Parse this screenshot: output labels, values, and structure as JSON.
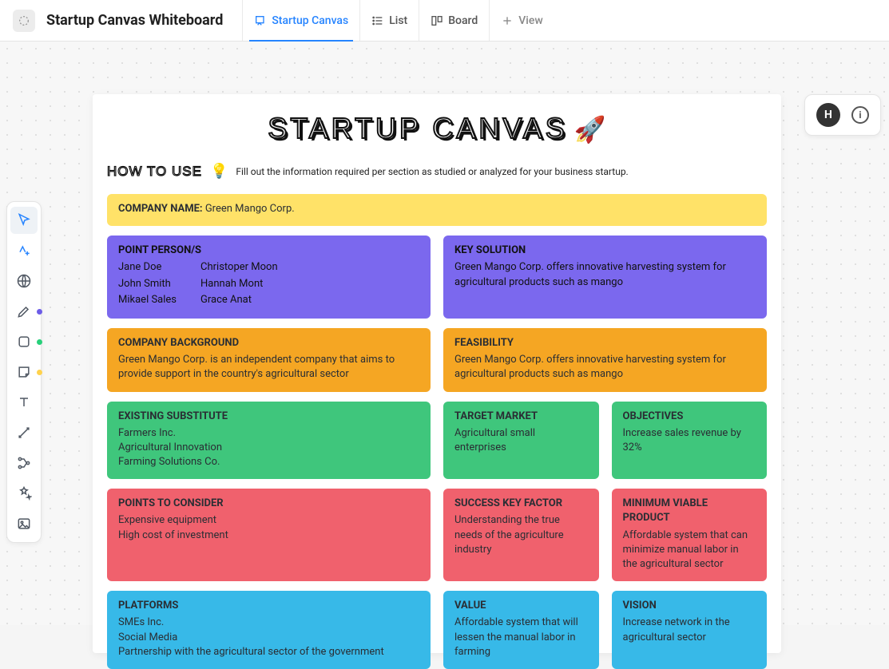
{
  "header": {
    "doc_title": "Startup Canvas Whiteboard",
    "tabs": {
      "canvas": "Startup Canvas",
      "list": "List",
      "board": "Board",
      "view": "View"
    }
  },
  "right": {
    "avatar_initial": "H"
  },
  "canvas": {
    "title": "STARTUP CANVAS",
    "rocket": "🚀",
    "howto_title": "HOW TO USE",
    "bulb": "💡",
    "howto_desc": "Fill out the information required per section as studied or analyzed for your business startup."
  },
  "cards": {
    "company_name": {
      "label": "COMPANY NAME:",
      "value": "Green Mango Corp."
    },
    "point_persons": {
      "label": "POINT PERSON/S",
      "col1": [
        "Jane Doe",
        "John Smith",
        "Mikael Sales"
      ],
      "col2": [
        "Christoper Moon",
        "Hannah Mont",
        "Grace Anat"
      ]
    },
    "key_solution": {
      "label": "KEY SOLUTION",
      "body": "Green Mango Corp. offers innovative harvesting system for agricultural products such as mango"
    },
    "company_background": {
      "label": "COMPANY BACKGROUND",
      "body": "Green Mango Corp. is an independent company that aims to provide support in the country's agricultural sector"
    },
    "feasibility": {
      "label": "FEASIBILITY",
      "body": "Green Mango Corp. offers innovative harvesting system for agricultural products such as mango"
    },
    "existing_substitute": {
      "label": "EXISTING SUBSTITUTE",
      "lines": [
        "Farmers Inc.",
        "Agricultural Innovation",
        "Farming Solutions Co."
      ]
    },
    "target_market": {
      "label": "TARGET MARKET",
      "body": "Agricultural small enterprises"
    },
    "objectives": {
      "label": "OBJECTIVES",
      "body": "Increase sales revenue by 32%"
    },
    "points_to_consider": {
      "label": "POINTS TO CONSIDER",
      "lines": [
        "Expensive equipment",
        "High cost of investment"
      ]
    },
    "success_key_factor": {
      "label": "SUCCESS KEY FACTOR",
      "body": "Understanding the true needs of the agriculture industry"
    },
    "mvp": {
      "label": "MINIMUM VIABLE PRODUCT",
      "body": "Affordable system that can minimize manual labor in the agricultural sector"
    },
    "platforms": {
      "label": "PLATFORMS",
      "lines": [
        "SMEs Inc.",
        "Social Media",
        "Partnership with the agricultural sector of the government"
      ]
    },
    "value": {
      "label": "VALUE",
      "body": "Affordable system that will lessen the manual labor in farming"
    },
    "vision": {
      "label": "VISION",
      "body": "Increase network in the agricultural sector"
    }
  }
}
